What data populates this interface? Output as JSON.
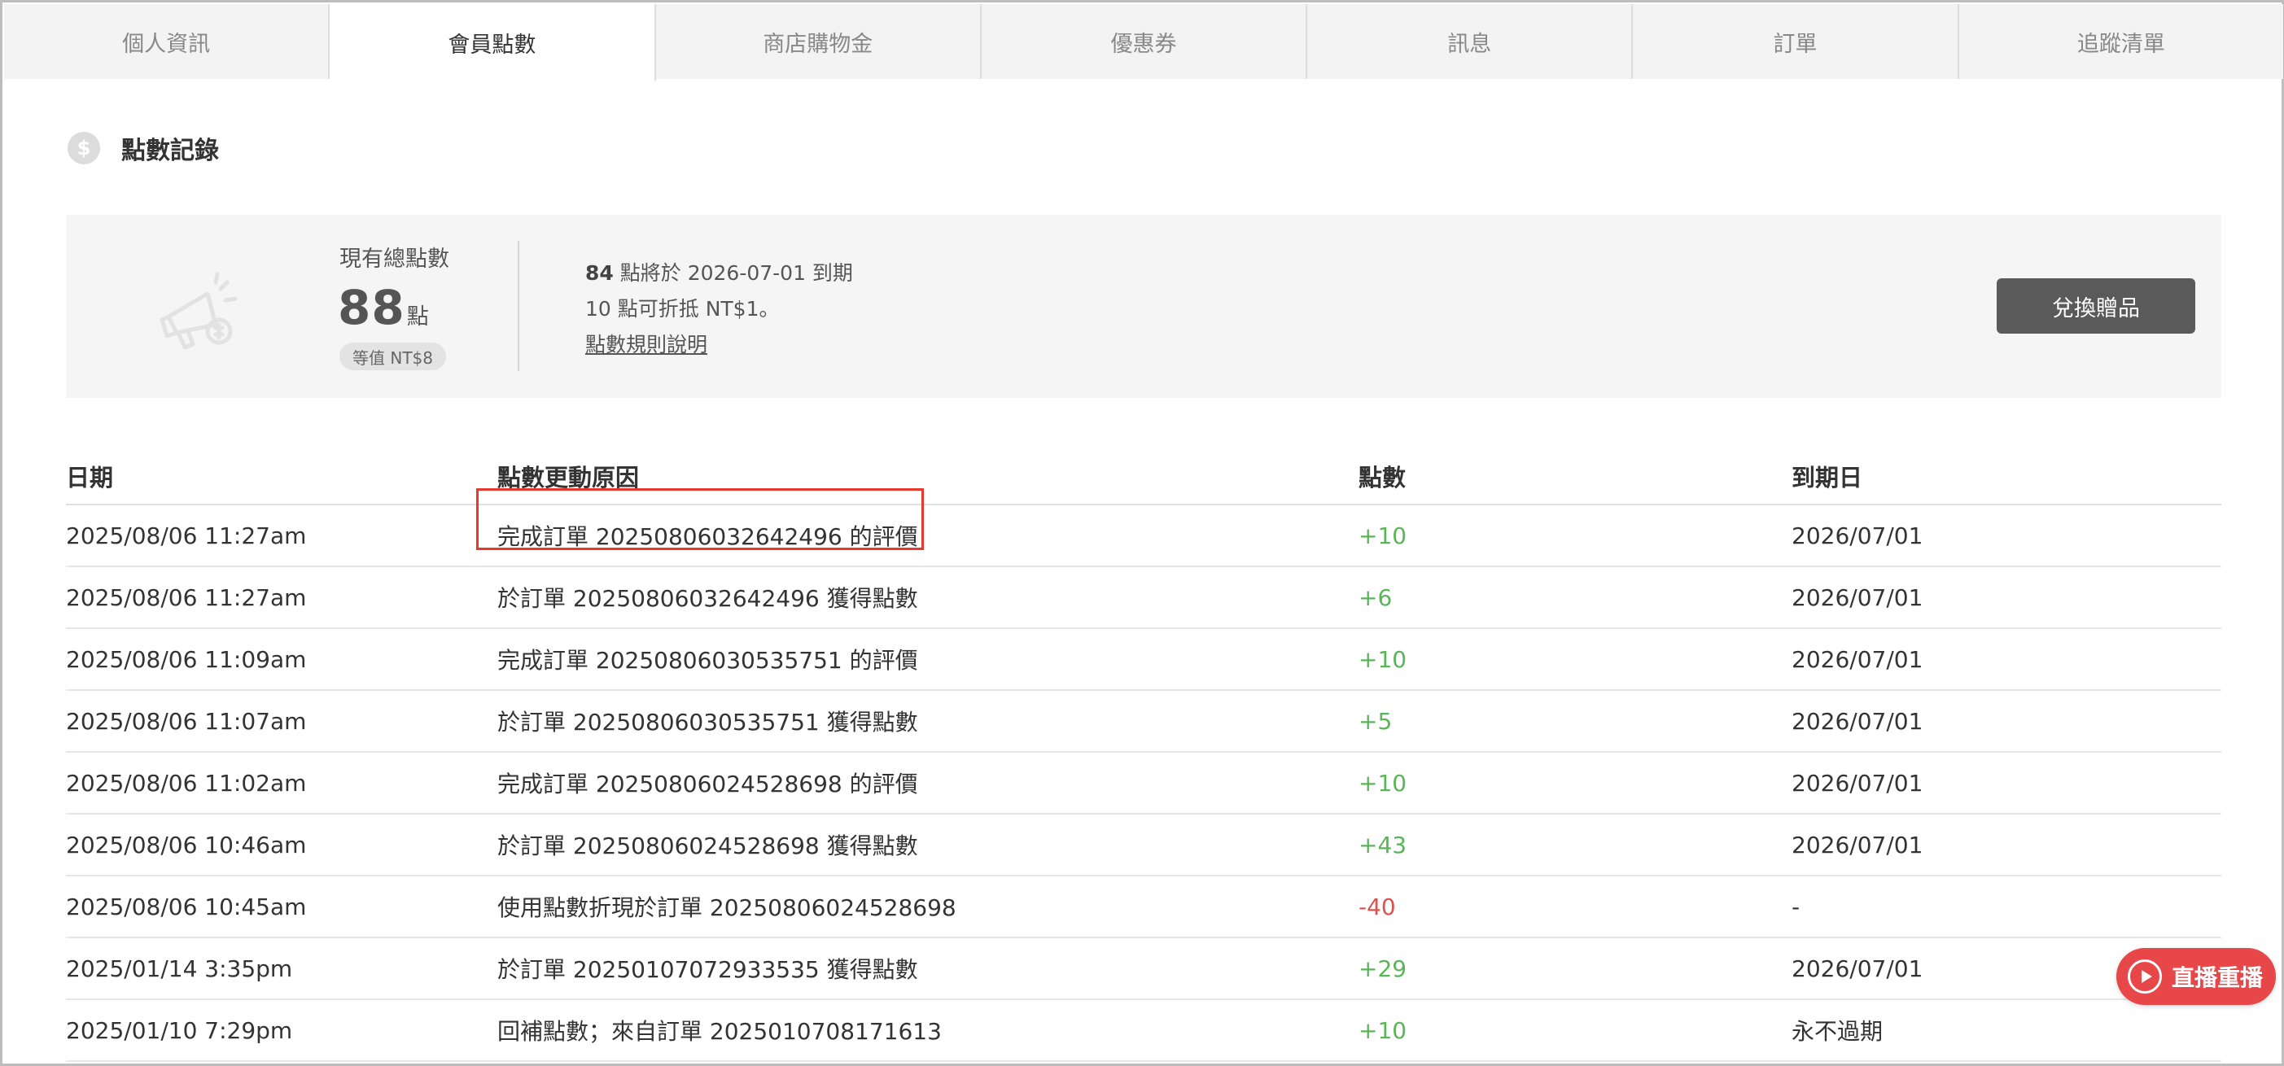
{
  "tabs": [
    {
      "label": "個人資訊",
      "active": false
    },
    {
      "label": "會員點數",
      "active": true
    },
    {
      "label": "商店購物金",
      "active": false
    },
    {
      "label": "優惠券",
      "active": false
    },
    {
      "label": "訊息",
      "active": false
    },
    {
      "label": "訂單",
      "active": false
    },
    {
      "label": "追蹤清單",
      "active": false
    }
  ],
  "section": {
    "icon": "dollar-coin-icon",
    "title": "點數記錄"
  },
  "summary": {
    "icon": "megaphone-icon",
    "total_label": "現有總點數",
    "total_points": "88",
    "unit": "點",
    "equivalent": "等值 NT$8",
    "expiring_points": "84",
    "expiring_text": " 點將於 2026-07-01 到期",
    "conversion_text": "10 點可折抵 NT$1。",
    "rules_link": "點數規則說明",
    "redeem_button": "兌換贈品"
  },
  "table": {
    "headers": {
      "date": "日期",
      "reason": "點數更動原因",
      "points": "點數",
      "expiry": "到期日"
    },
    "rows": [
      {
        "date": "2025/08/06 11:27am",
        "reason": "完成訂單 20250806032642496 的評價",
        "points": "+10",
        "expiry": "2026/07/01"
      },
      {
        "date": "2025/08/06 11:27am",
        "reason": "於訂單 20250806032642496 獲得點數",
        "points": "+6",
        "expiry": "2026/07/01"
      },
      {
        "date": "2025/08/06 11:09am",
        "reason": "完成訂單 20250806030535751 的評價",
        "points": "+10",
        "expiry": "2026/07/01"
      },
      {
        "date": "2025/08/06 11:07am",
        "reason": "於訂單 20250806030535751 獲得點數",
        "points": "+5",
        "expiry": "2026/07/01"
      },
      {
        "date": "2025/08/06 11:02am",
        "reason": "完成訂單 20250806024528698 的評價",
        "points": "+10",
        "expiry": "2026/07/01"
      },
      {
        "date": "2025/08/06 10:46am",
        "reason": "於訂單 20250806024528698 獲得點數",
        "points": "+43",
        "expiry": "2026/07/01"
      },
      {
        "date": "2025/08/06 10:45am",
        "reason": "使用點數折現於訂單 20250806024528698",
        "points": "-40",
        "expiry": "-"
      },
      {
        "date": "2025/01/14 3:35pm",
        "reason": "於訂單 20250107072933535 獲得點數",
        "points": "+29",
        "expiry": "2026/07/01"
      },
      {
        "date": "2025/01/10 7:29pm",
        "reason": "回補點數；來自訂單 2025010708171613",
        "points": "+10",
        "expiry": "永不過期"
      }
    ]
  },
  "live_button": {
    "icon": "play-circle-icon",
    "label": "直播重播"
  },
  "colors": {
    "positive": "#5ab55a",
    "negative": "#d9534f",
    "highlight": "#e8392e",
    "live": "#e8474a",
    "button": "#5a5a5a"
  }
}
